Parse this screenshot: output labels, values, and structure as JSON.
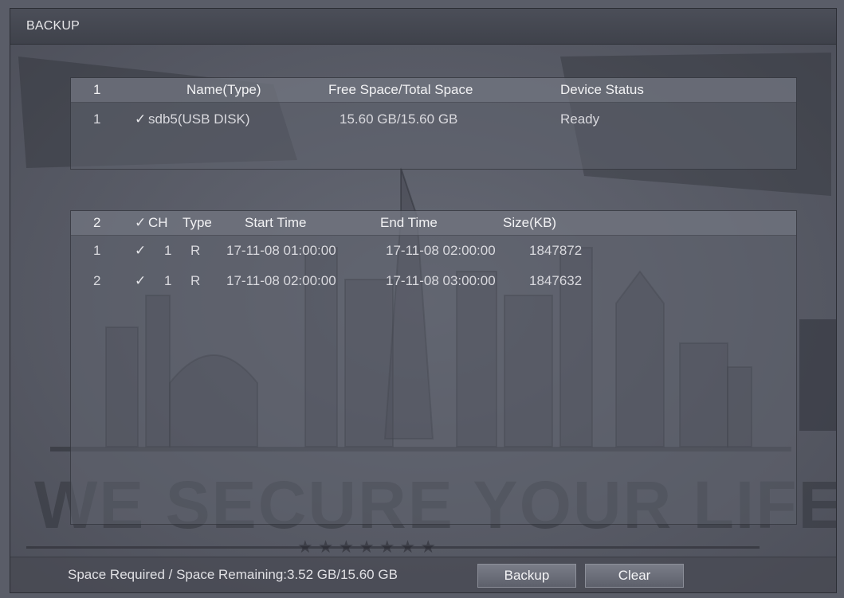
{
  "window": {
    "title": "BACKUP"
  },
  "devices": {
    "header": {
      "index": "1",
      "name": "Name(Type)",
      "space": "Free Space/Total Space",
      "status": "Device Status"
    },
    "rows": [
      {
        "index": "1",
        "check": "✓",
        "name": "sdb5(USB DISK)",
        "space": "15.60 GB/15.60 GB",
        "status": "Ready"
      }
    ]
  },
  "files": {
    "header": {
      "index": "2",
      "check": "✓",
      "ch": "CH",
      "type": "Type",
      "start": "Start Time",
      "end": "End Time",
      "size": "Size(KB)"
    },
    "rows": [
      {
        "index": "1",
        "check": "✓",
        "ch": "1",
        "type": "R",
        "start": "17-11-08 01:00:00",
        "end": "17-11-08 02:00:00",
        "size": "1847872"
      },
      {
        "index": "2",
        "check": "✓",
        "ch": "1",
        "type": "R",
        "start": "17-11-08 02:00:00",
        "end": "17-11-08 03:00:00",
        "size": "1847632"
      }
    ]
  },
  "footer": {
    "space_text": "Space Required / Space Remaining:3.52 GB/15.60 GB",
    "backup_label": "Backup",
    "clear_label": "Clear"
  },
  "watermark": {
    "slogan": "WE SECURE YOUR LIFE"
  }
}
